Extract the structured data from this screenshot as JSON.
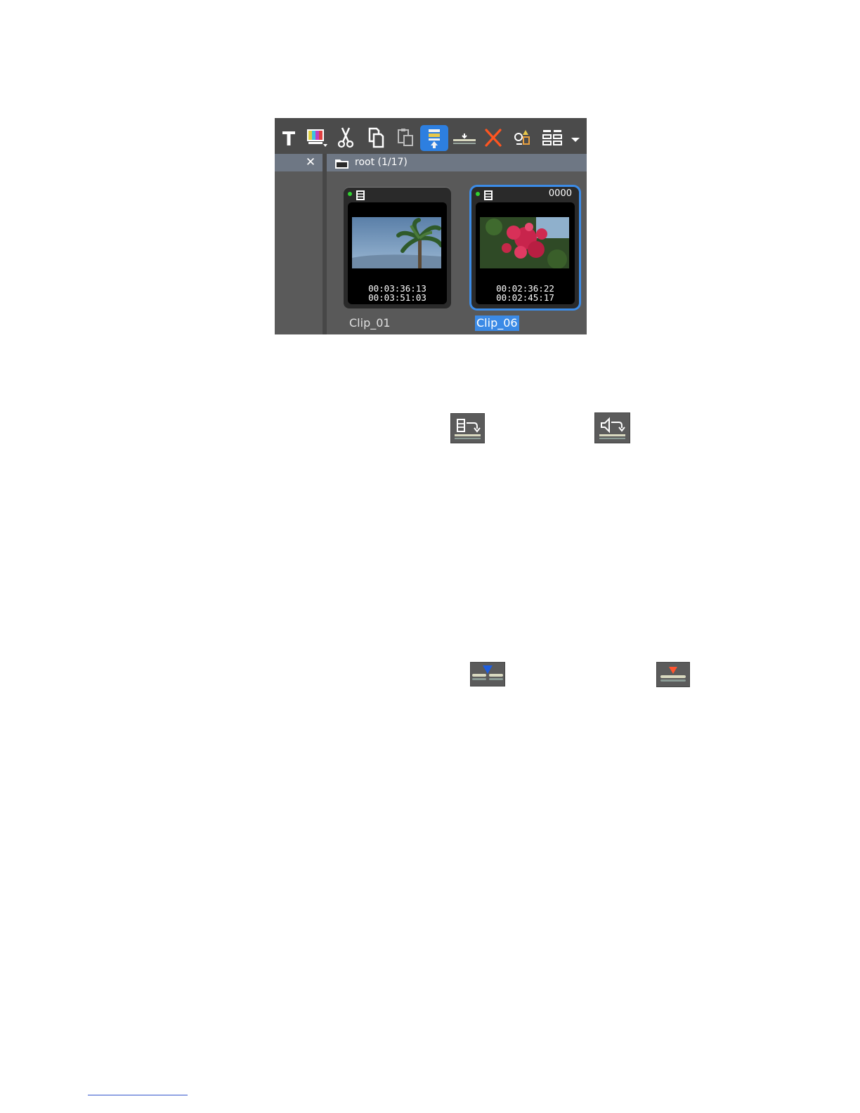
{
  "toolbar": {
    "icons": [
      "title-icon",
      "color-bars-icon",
      "cut-icon",
      "copy-icon",
      "paste-icon",
      "insert-to-timeline-icon",
      "overwrite-icon",
      "delete-icon",
      "effects-icon",
      "view-icon",
      "dropdown-icon"
    ],
    "active_icon": "insert-to-timeline-icon"
  },
  "bin": {
    "close_glyph": "✕",
    "folder_path": "root (1/17)"
  },
  "clips": [
    {
      "name": "Clip_01",
      "counter": "",
      "tc_in": "00:03:36:13",
      "tc_out": "00:03:51:03",
      "selected": false
    },
    {
      "name": "Clip_06",
      "counter": "0000",
      "tc_in": "00:02:36:22",
      "tc_out": "00:02:45:17",
      "selected": true
    }
  ],
  "inline_icons": [
    "video-sync-icon",
    "audio-sync-icon",
    "blue-marker-icon",
    "red-marker-icon"
  ],
  "colors": {
    "accent": "#2d7fe0",
    "selection": "#3b8ae6",
    "panel": "#555555"
  }
}
